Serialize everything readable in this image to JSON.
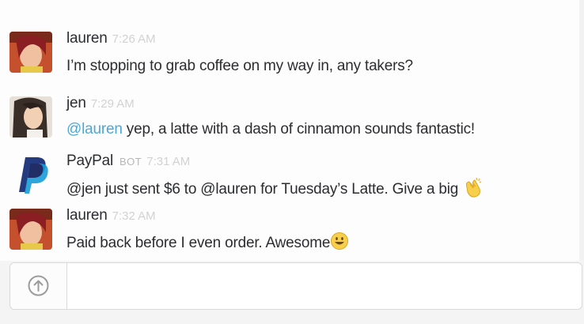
{
  "messages": [
    {
      "name": "lauren",
      "bot_label": "",
      "time": "7:26 AM",
      "mention": "",
      "text": "I’m stopping to grab coffee on my way in, any takers?"
    },
    {
      "name": "jen",
      "bot_label": "",
      "time": "7:29 AM",
      "mention": "@lauren",
      "text": " yep, a latte with a dash of cinnamon sounds fantastic!"
    },
    {
      "name": "PayPal",
      "bot_label": "BOT",
      "time": "7:31 AM",
      "mention": "",
      "text": "@jen just sent $6 to @lauren for Tuesday’s Latte. Give a big ",
      "emoji": "clapping-hands-icon"
    },
    {
      "name": "lauren",
      "bot_label": "",
      "time": "7:32 AM",
      "mention": "",
      "text": "Paid back before I even order.  Awesome",
      "emoji": "smiley-icon"
    }
  ],
  "composer": {
    "placeholder": "",
    "upload_icon": "upload-arrow-icon"
  },
  "colors": {
    "mention": "#4aa8d8",
    "timestamp": "#d2d2d2",
    "paypal_dark": "#253b80",
    "paypal_light": "#179bd7"
  }
}
